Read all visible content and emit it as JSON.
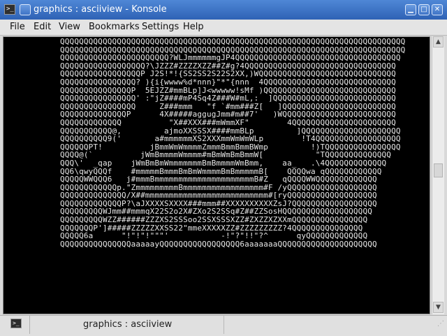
{
  "window": {
    "title": "graphics : asciiview - Konsole",
    "buttons": {
      "minimize": "▁",
      "maximize": "□",
      "close": "✕"
    }
  },
  "menubar": {
    "items": [
      {
        "id": "file",
        "label": "File"
      },
      {
        "id": "edit",
        "label": "Edit"
      },
      {
        "id": "view",
        "label": "View"
      },
      {
        "id": "bookmarks",
        "label": "Bookmarks"
      },
      {
        "id": "settings",
        "label": "Settings"
      },
      {
        "id": "help",
        "label": "Help"
      }
    ]
  },
  "terminal": {
    "ascii_art": "QQQQQQQQQQQQQQQQQQQQQQQQQQQQQQQQQQQQQQQQQQQQQQQQQQQQQQQQQQQQQQQQQQQQQQQQQ\nQQQQQQQQQQQQQQQQQQQQQQQQQQQQQQQQQQQQQQQQQQQQQQQQQQQQQQQQQQQQQQQQQQQQQQQQQ\nQQQQQQQQQQQQQQQQQQQQQQQ?WLJmmmmmmgJP4QQQQQQQQQQQQQQQQQQQQQQQQQQQQQQQQQQQ\nQQQQQQQQQQQQQQQQQQ?\\JZZZ#ZZZZXZZ##Z#g?4QQQQQQQQQQQQQQQQQQQQQQQQQQQQQQQQ\nQQQQQQQQQQQQQQQQQP J2S!*!{SS2SS2S22S2XX,)WQQQQQQQQQQQQQQQQQQQQQQQQQQQQQ\nQQQQQQQQQQQQQQQQ? ){i{wwww%d*nnn}\"*\"{nnn  4QQQQQQQQQQQQQQQQQQQQQQQQQQQQ\nQQQQQQQQQQQQQQQP  5EJZZ#mmBLp]J<wwwww!sMf )QQQQQQQQQQQQQQQQQQQQQQQQQQQQ\nQQQQQQQQQQQQQQQQ' :\"jZ####mP4Sq4Z###W#mL,:  ]QQQQQQQQQQQQQQQQQQQQQQQQQQ\nQQQQQQQQQQQQQQQQ     Z###mmm   \"f `#mm###Z[   ]QQQQQQQQQQQQQQQQQQQQQQQQ\nQQQQQQQQQQQQQQP      4X#####aggugJmm#m##7'   )WQQQQQQQQQQQQQQQQQQQQQQQQ\nQQQQQQQQQQQQQ          \"X##XXX###mWmmXF\"        4QQQQQQQQQQQQQQQQQQQQQQ\nQQQQQQQQQQQ@,         ajmoXXSSSX####mmBLp         ]QQQQQQQQQQQQQQQQQQQQQ\nQQQQQQQQQQ9('       a#mmmmmmXS2XXXmmWmWmWLp        !T4QQQQQQQQQQQQQQQQQQ\nQQQQQQPT!          jBmmWmWmmmmZmmmBmmBmmBWmp         !)TQQQQQQQQQQQQQQQQ\nQQQQ@(`          jWmBmmmmWmmmm#mBmWmBmBmmW[           \"TQQQQQQQQQQQQQQ\nQQQ\\'  _qap    jWmBmBmWmmmmmmmBmBmmmmWmBmm,    aa_   .\\4QQQQQQQQQQQQQ\nQQ6\\qwyQQQf    #mmmmmBmmmBmBmWmmmmBmBmmmmmB[    QQQQwa qQQQQQQQQQQQQ\nQQQQQWWQQQ6   j#mmmBmmmmmmmmmmmmmmmmmmmmmB#Z   qQQQQWWQQQQQQQQQQQQQ\nQQQQQQQQQQQQp.\"ZmmmmmmmmmBmmmmmmmmmmmmmmmmm#F /yQQQQQQQQQQQQQQQQQQQ\nQQQQQQQQQQQQQQ/X##mmmmmmmmmmmmmmmmmmmmmmmmmm#[ryQQQQQQQQQQQQQQQQQQQ\nQQQQQQQQQQQQQP?\\aJXXXXSXXXX###mmm##XXXXXXXXXXZsJ?QQQQQQQQQQQQQQQQQQ\nQQQQQQQQQWJmm##mmmqX22S2o2X#ZXo2S2SSq#Z##ZZSosHQQQQQQQQQQQQQQQQQQQ\nQQQQQQQQQWZZ######ZZZXS2SSSoo2SSXSSSXZZ#ZXZZXZXXmQQQQQQQQQQQQQQQQ\nQQQQQQQP']#####ZZZZZXXSS22\"mmeXXXXXZZ#ZZZZZZZZZ?4QQQQQQQQQQQQQQQ\nQQQQQ6a      \"!\"!\"!\"\"\"'           -!\"?\"!!\"?^      qyQQQQQQQQQQQQQ\nQQQQQQQQQQQQQQQaaaaayQQQQQQQQQQQQQQQQQ6aaaaaaaQQQQQQQQQQQQQQQQQQQQQ"
  },
  "statusbar": {
    "tab_label": "graphics : asciiview"
  }
}
